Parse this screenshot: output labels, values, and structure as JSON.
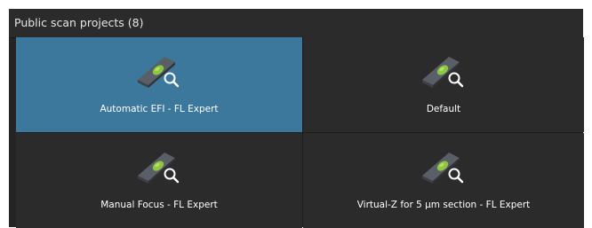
{
  "header": {
    "title": "Public scan projects (8)"
  },
  "icons": {
    "tile_icon": "slide-scan-search-icon"
  },
  "colors": {
    "panel_bg": "#252525",
    "tile_bg": "#2b2b2b",
    "selected_bg": "#3c789b",
    "accent_green": "#8dc63f"
  },
  "projects": [
    {
      "label": "Automatic EFI - FL Expert",
      "selected": true
    },
    {
      "label": "Default",
      "selected": false
    },
    {
      "label": "Manual Focus - FL Expert",
      "selected": false
    },
    {
      "label": "Virtual-Z for 5 µm section - FL Expert",
      "selected": false
    }
  ]
}
